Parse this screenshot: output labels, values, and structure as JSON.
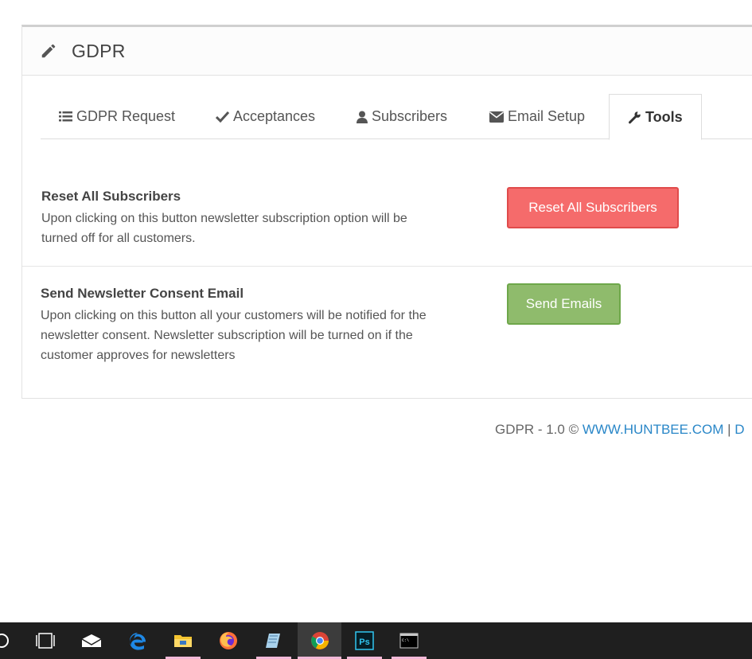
{
  "panel": {
    "title": "GDPR",
    "pencil_icon": "pencil-icon"
  },
  "tabs": [
    {
      "label": "GDPR Request",
      "icon": "list-icon"
    },
    {
      "label": "Acceptances",
      "icon": "check-icon"
    },
    {
      "label": "Subscribers",
      "icon": "user-icon"
    },
    {
      "label": "Email Setup",
      "icon": "envelope-icon"
    },
    {
      "label": "Tools",
      "icon": "wrench-icon",
      "active": true
    }
  ],
  "tools": {
    "reset": {
      "title": "Reset All Subscribers",
      "desc_line1": "Upon clicking on this button newsletter subscription option will be",
      "desc_line2": "turned off for all customers.",
      "button": "Reset All Subscribers"
    },
    "consent": {
      "title": "Send Newsletter Consent Email",
      "desc_line1": "Upon clicking on this button all your customers will be notified for the",
      "desc_line2": "newsletter consent. Newsletter subscription will be turned on if the",
      "desc_line3": "customer approves for newsletters",
      "button": "Send Emails"
    }
  },
  "footer": {
    "text": "GDPR - 1.0 © ",
    "link": "WWW.HUNTBEE.COM",
    "separator": " | ",
    "trailing": "D"
  },
  "taskbar": {
    "items": [
      "cortana-icon",
      "task-view-icon",
      "mail-icon",
      "edge-icon",
      "file-explorer-icon",
      "firefox-icon",
      "notepad-icon",
      "chrome-icon",
      "photoshop-icon",
      "terminal-icon"
    ],
    "photoshop_label": "Ps",
    "terminal_label": "C:\\"
  },
  "colors": {
    "danger": "#f56b6b",
    "success": "#8fbb6c",
    "link": "#2a87c8",
    "taskbar": "#1f1f1f"
  }
}
